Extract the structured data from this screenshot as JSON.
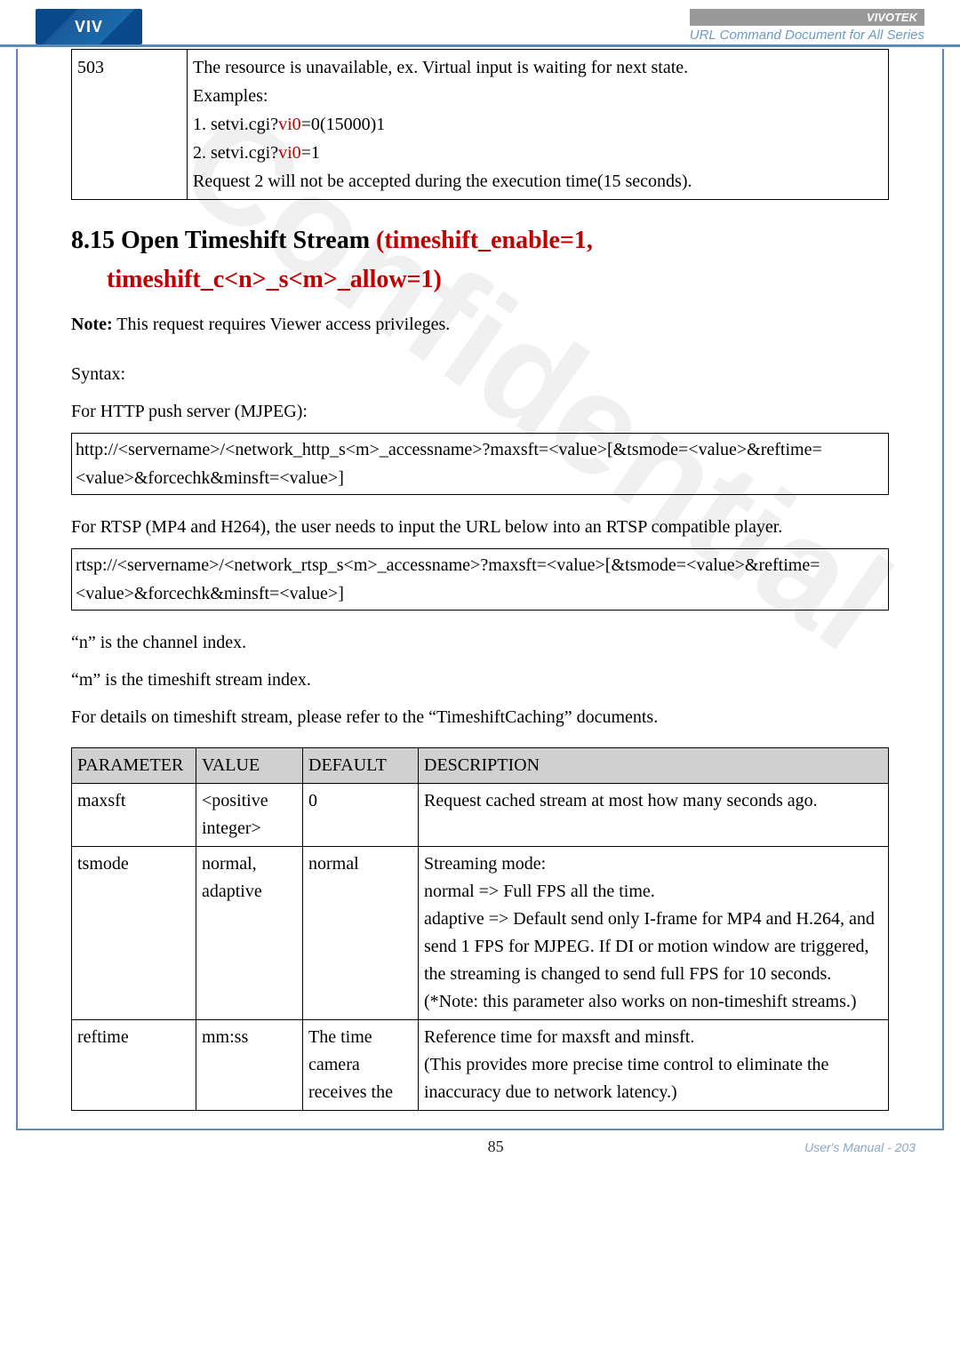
{
  "header": {
    "brand": "VIVOTEK",
    "doc_title": "URL Command Document for All Series",
    "logo_text": "VIV"
  },
  "watermark": "Confidential",
  "top_table": {
    "code": "503",
    "lines": {
      "l1": "The resource is unavailable, ex. Virtual input is waiting for next state.",
      "l2": "Examples:",
      "l3a": "1. setvi.cgi?",
      "l3b": "vi0",
      "l3c": "=0(15000)1",
      "l4a": "2. setvi.cgi?",
      "l4b": "vi0",
      "l4c": "=1",
      "l5": "Request 2 will not be accepted during the execution time(15 seconds)."
    }
  },
  "section": {
    "num_title_a": "8.15 Open Timeshift Stream ",
    "num_title_b": "(timeshift_enable=1,",
    "sub": "timeshift_c<n>_s<m>_allow=1)",
    "note": "Note: This request requires Viewer access privileges.",
    "syntax_label": "Syntax:",
    "http_label": "For HTTP push server (MJPEG):",
    "http_box": "http://<servername>/<network_http_s<m>_accessname>?maxsft=<value>[&tsmode=<value>&reftime=<value>&forcechk&minsft=<value>]",
    "rtsp_label": "For RTSP (MP4 and H264), the user needs to input the URL below into an RTSP compatible player.",
    "rtsp_box": "rtsp://<servername>/<network_rtsp_s<m>_accessname>?maxsft=<value>[&tsmode=<value>&reftime=<value>&forcechk&minsft=<value>]",
    "n_note": "“n” is the channel index.",
    "m_note": "“m” is the timeshift stream index.",
    "details": "For details on timeshift stream, please refer to the “TimeshiftCaching” documents."
  },
  "params": {
    "headers": {
      "c1": "PARAMETER",
      "c2": "VALUE",
      "c3": "DEFAULT",
      "c4": "DESCRIPTION"
    },
    "rows": [
      {
        "p": "maxsft",
        "v": "<positive integer>",
        "d": "0",
        "desc": "Request cached stream at most how many seconds ago."
      },
      {
        "p": "tsmode",
        "v": "normal, adaptive",
        "d": "normal",
        "desc": "Streaming mode:\nnormal => Full FPS all the time.\nadaptive => Default send only I-frame for MP4 and H.264, and send 1 FPS for MJPEG. If DI or motion window are triggered, the streaming is changed to send full FPS for 10 seconds.\n(*Note: this parameter also works on non-timeshift streams.)"
      },
      {
        "p": "reftime",
        "v": "mm:ss",
        "d": "The time camera receives the",
        "desc": "Reference time for maxsft and minsft.\n(This provides more precise time control to eliminate the inaccuracy due to network latency.)"
      }
    ]
  },
  "footer": {
    "page": "85",
    "manual": "User's Manual - 203"
  }
}
